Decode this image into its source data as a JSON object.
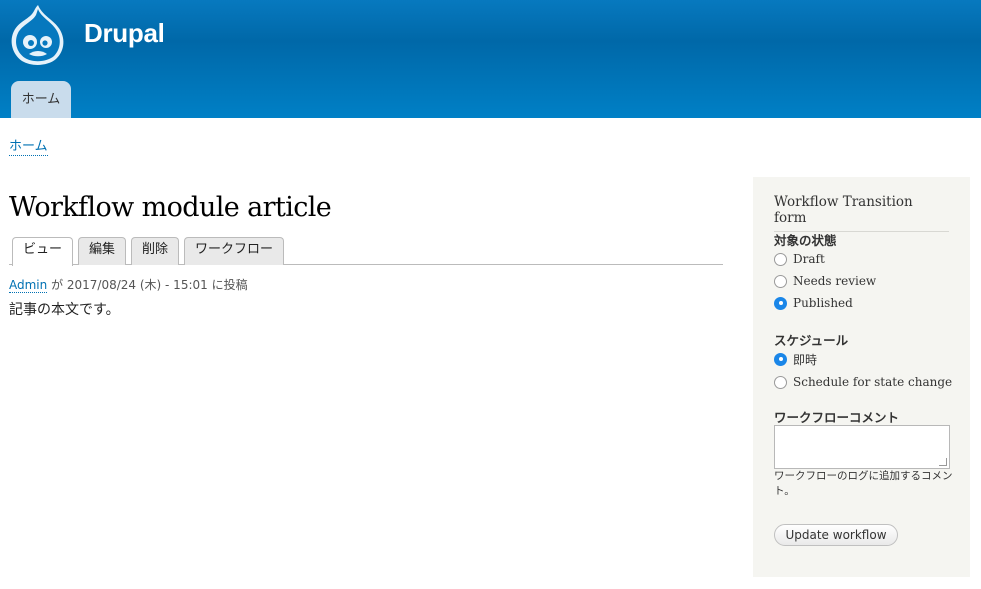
{
  "header": {
    "site_name": "Drupal",
    "nav_home": "ホーム"
  },
  "breadcrumb": {
    "home": "ホーム"
  },
  "main": {
    "title": "Workflow module article",
    "tabs": [
      {
        "label": "ビュー",
        "active": true
      },
      {
        "label": "編集"
      },
      {
        "label": "削除"
      },
      {
        "label": "ワークフロー"
      }
    ],
    "author": "Admin",
    "submitted_text": " が 2017/08/24 (木) - 15:01 に投稿",
    "body": "記事の本文です。"
  },
  "sidebar": {
    "title": "Workflow Transition form",
    "state_label": "対象の状態",
    "states": [
      {
        "label": "Draft",
        "checked": false
      },
      {
        "label": "Needs review",
        "checked": false
      },
      {
        "label": "Published",
        "checked": true
      }
    ],
    "schedule_label": "スケジュール",
    "schedule_options": [
      {
        "label": "即時",
        "checked": true
      },
      {
        "label": "Schedule for state change",
        "checked": false
      }
    ],
    "comment_label": "ワークフローコメント",
    "comment_value": "",
    "comment_description": "ワークフローのログに追加するコメント。",
    "submit_label": "Update workflow"
  },
  "colors": {
    "header_blue": "#0077c0",
    "link": "#0071b3",
    "radio_checked": "#1a86e8",
    "sidebar_bg": "#f5f5f1"
  }
}
